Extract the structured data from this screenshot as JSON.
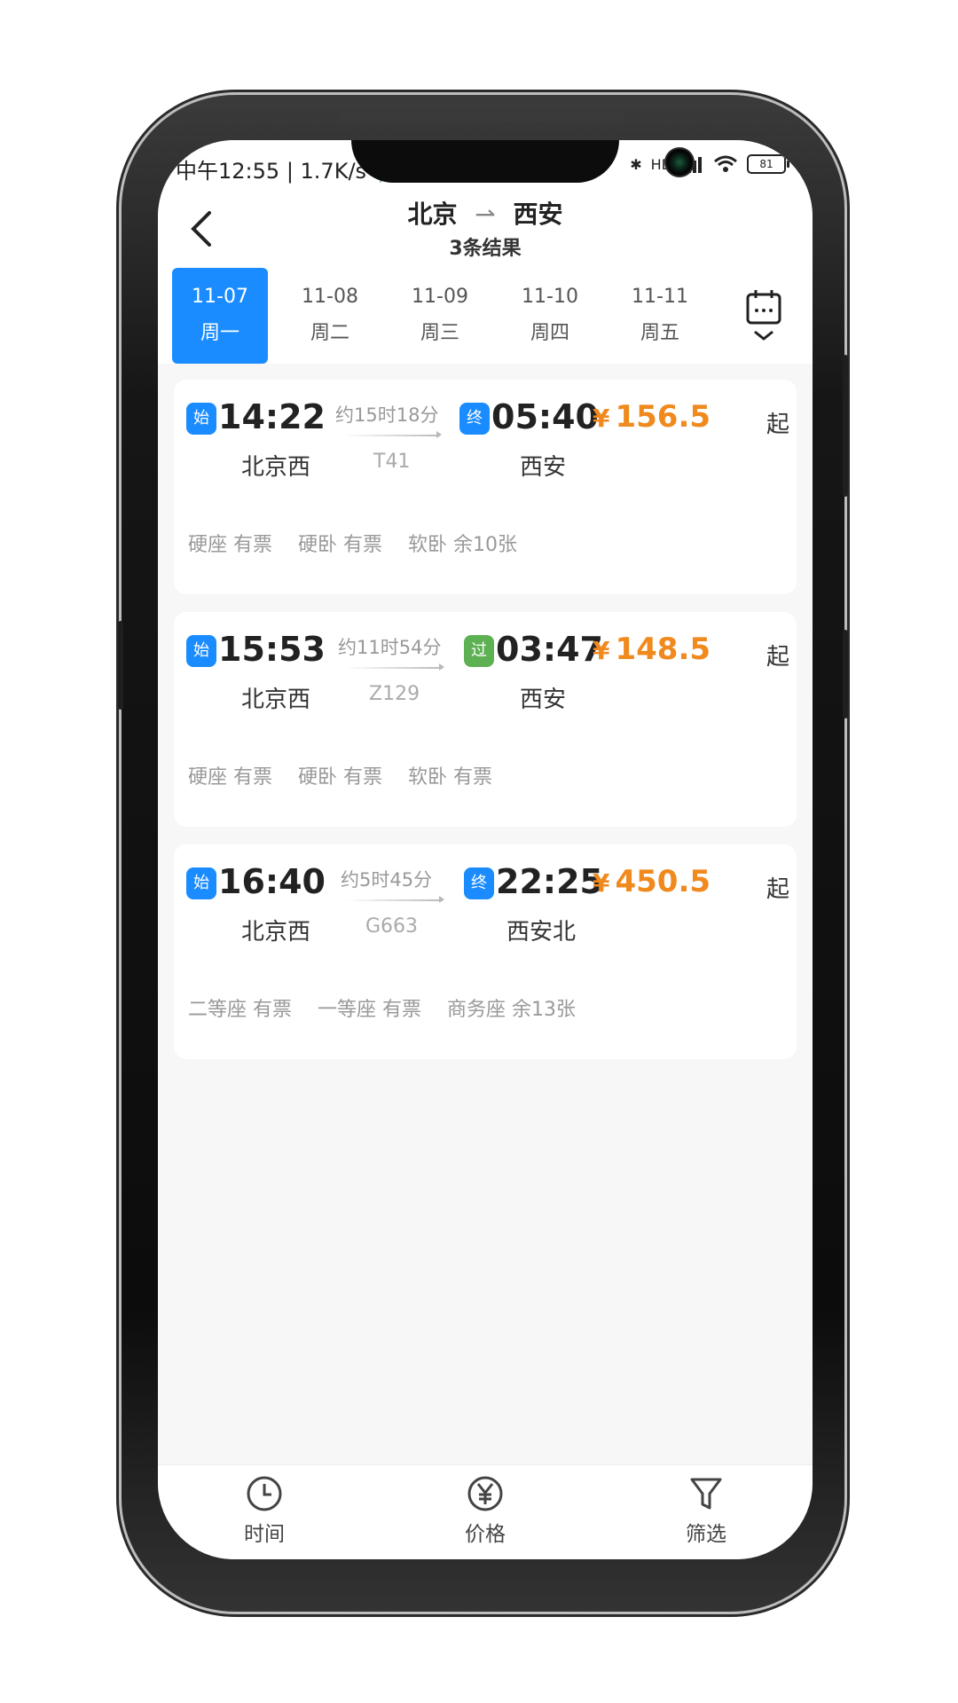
{
  "status_bar": {
    "time": "中午12:55",
    "speed": "1.7K/s",
    "network": "HD",
    "battery": "81"
  },
  "header": {
    "from": "北京",
    "to": "西安",
    "results": "3条结果"
  },
  "dates": [
    {
      "date": "11-07",
      "weekday": "周一",
      "active": true
    },
    {
      "date": "11-08",
      "weekday": "周二",
      "active": false
    },
    {
      "date": "11-09",
      "weekday": "周三",
      "active": false
    },
    {
      "date": "11-10",
      "weekday": "周四",
      "active": false
    },
    {
      "date": "11-11",
      "weekday": "周五",
      "active": false
    }
  ],
  "trains": [
    {
      "start_badge": "始",
      "depart": "14:22",
      "duration": "约15时18分",
      "train_no": "T41",
      "end_badge": "终",
      "end_badge_color": "#1a8cff",
      "arrive": "05:40",
      "from_station": "北京西",
      "to_station": "西安",
      "price_symbol": "¥",
      "price": "156.5",
      "price_suffix": "起",
      "seats": [
        "硬座 有票",
        "硬卧 有票",
        "软卧 余10张"
      ]
    },
    {
      "start_badge": "始",
      "depart": "15:53",
      "duration": "约11时54分",
      "train_no": "Z129",
      "end_badge": "过",
      "end_badge_color": "#5db152",
      "arrive": "03:47",
      "from_station": "北京西",
      "to_station": "西安",
      "price_symbol": "¥",
      "price": "148.5",
      "price_suffix": "起",
      "seats": [
        "硬座 有票",
        "硬卧 有票",
        "软卧 有票"
      ]
    },
    {
      "start_badge": "始",
      "depart": "16:40",
      "duration": "约5时45分",
      "train_no": "G663",
      "end_badge": "终",
      "end_badge_color": "#1a8cff",
      "arrive": "22:25",
      "from_station": "北京西",
      "to_station": "西安北",
      "price_symbol": "¥",
      "price": "450.5",
      "price_suffix": "起",
      "seats": [
        "二等座 有票",
        "一等座 有票",
        "商务座 余13张"
      ]
    }
  ],
  "tabs": [
    {
      "label": "时间",
      "icon": "clock-icon"
    },
    {
      "label": "价格",
      "icon": "yen-icon"
    },
    {
      "label": "筛选",
      "icon": "filter-icon"
    }
  ],
  "colors": {
    "accent": "#1a8cff",
    "price": "#f08a1e",
    "pass_badge": "#5db152"
  }
}
